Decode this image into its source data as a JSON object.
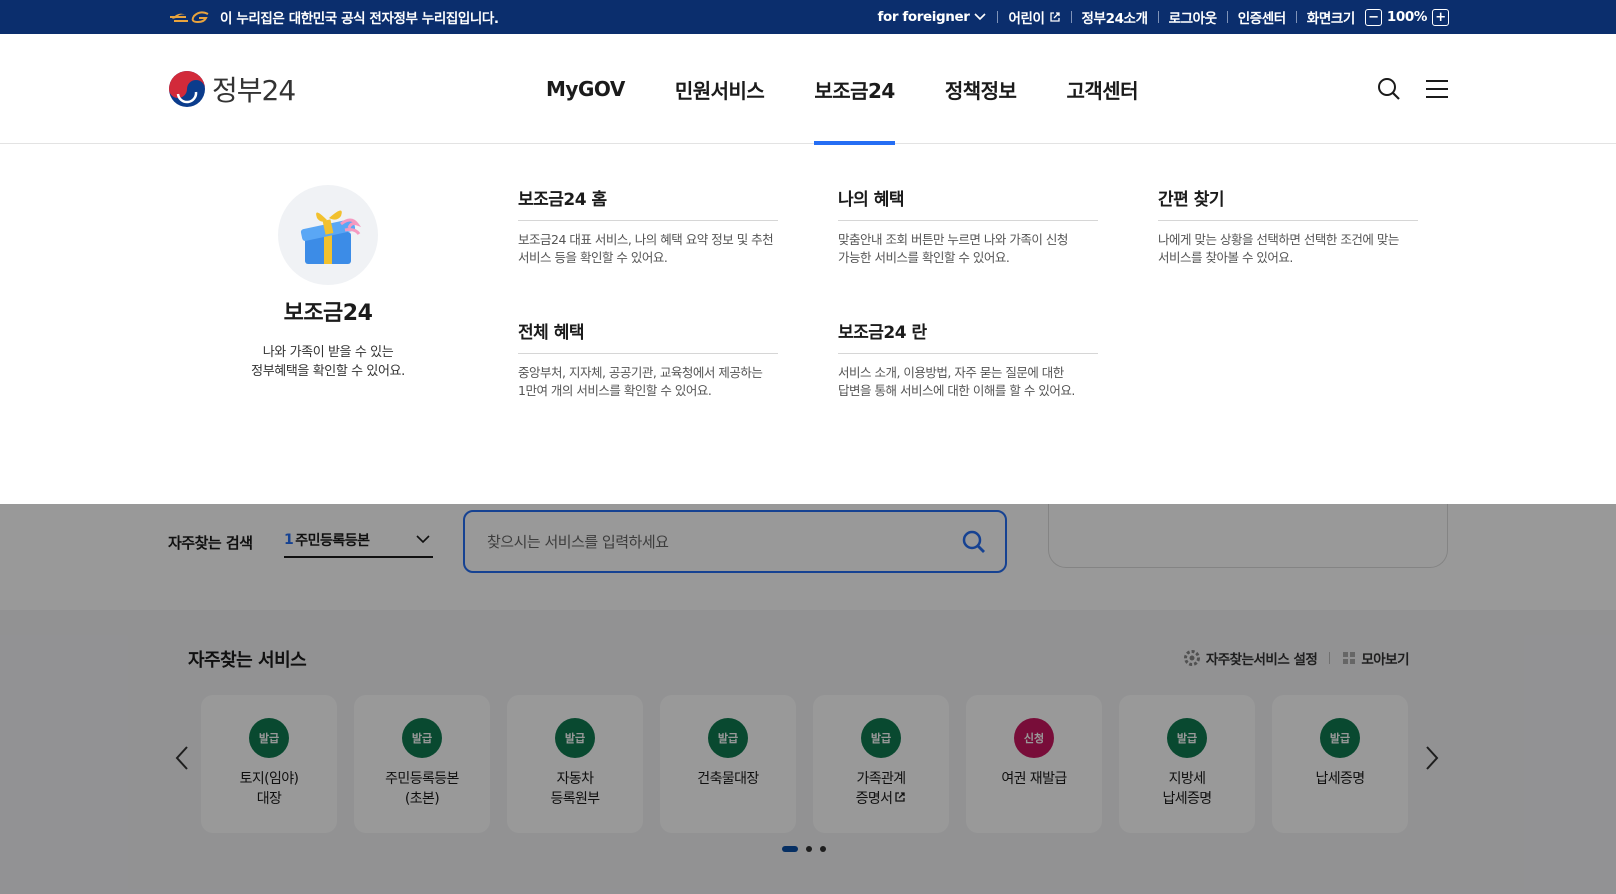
{
  "topbar": {
    "notice": "이 누리집은 대한민국 공식 전자정부 누리집입니다.",
    "links": [
      "for foreigner",
      "어린이",
      "정부24소개",
      "로그아웃",
      "인증센터"
    ],
    "zoom_label": "화면크기",
    "zoom_minus": "−",
    "zoom_value": "100%",
    "zoom_plus": "+"
  },
  "header": {
    "logo_text": "정부24",
    "nav": [
      "MyGOV",
      "민원서비스",
      "보조금24",
      "정책정보",
      "고객센터"
    ],
    "active_nav": "보조금24"
  },
  "mega_menu": {
    "intro_title": "보조금24",
    "intro_desc_line1": "나와 가족이 받을 수 있는",
    "intro_desc_line2": "정부혜택을 확인할 수 있어요.",
    "items": [
      {
        "title": "보조금24 홈",
        "desc_line1": "보조금24 대표 서비스, 나의 혜택 요약 정보 및 추천",
        "desc_line2": "서비스 등을 확인할 수 있어요."
      },
      {
        "title": "나의 혜택",
        "desc_line1": "맞춤안내 조회 버튼만 누르면 나와 가족이 신청",
        "desc_line2": "가능한 서비스를 확인할 수 있어요."
      },
      {
        "title": "간편 찾기",
        "desc_line1": "나에게 맞는 상황을 선택하면 선택한 조건에 맞는",
        "desc_line2": "서비스를 찾아볼 수 있어요."
      },
      {
        "title": "전체 혜택",
        "desc_line1": "중앙부처, 지자체, 공공기관, 교육청에서 제공하는",
        "desc_line2": "1만여 개의 서비스를 확인할 수 있어요."
      },
      {
        "title": "보조금24 란",
        "desc_line1": "서비스 소개, 이용방법, 자주 묻는 질문에 대한",
        "desc_line2": "답변을 통해 서비스에 대한 이해를 할 수 있어요."
      }
    ]
  },
  "search": {
    "freq_label": "자주찾는 검색",
    "freq_rank": "1",
    "freq_value": "주민등록등본",
    "placeholder": "찾으시는 서비스를 입력하세요"
  },
  "services": {
    "heading": "자주찾는 서비스",
    "settings_label": "자주찾는서비스 설정",
    "viewall_label": "모아보기",
    "cards": [
      {
        "badge": "발급",
        "line1": "토지(임야)",
        "line2": "대장"
      },
      {
        "badge": "발급",
        "line1": "주민등록등본",
        "line2": "(초본)"
      },
      {
        "badge": "발급",
        "line1": "자동차",
        "line2": "등록원부"
      },
      {
        "badge": "발급",
        "line1": "건축물대장",
        "line2": ""
      },
      {
        "badge": "발급",
        "line1": "가족관계",
        "line2": "증명서"
      },
      {
        "badge": "신청",
        "line1": "여권 재발급",
        "line2": ""
      },
      {
        "badge": "발급",
        "line1": "지방세",
        "line2": "납세증명"
      },
      {
        "badge": "발급",
        "line1": "납세증명",
        "line2": ""
      }
    ]
  },
  "colors": {
    "topbar_bg": "#0b2e6d",
    "accent": "#256ef4",
    "badge_issue": "#0f7a50",
    "badge_apply": "#c8175f"
  },
  "icons": [
    "eg-logo-icon",
    "chevron-down-icon",
    "external-link-icon",
    "search-icon",
    "hamburger-menu-icon",
    "gift-box-icon",
    "gear-icon",
    "grid-icon",
    "arrow-left-icon",
    "arrow-right-icon"
  ]
}
